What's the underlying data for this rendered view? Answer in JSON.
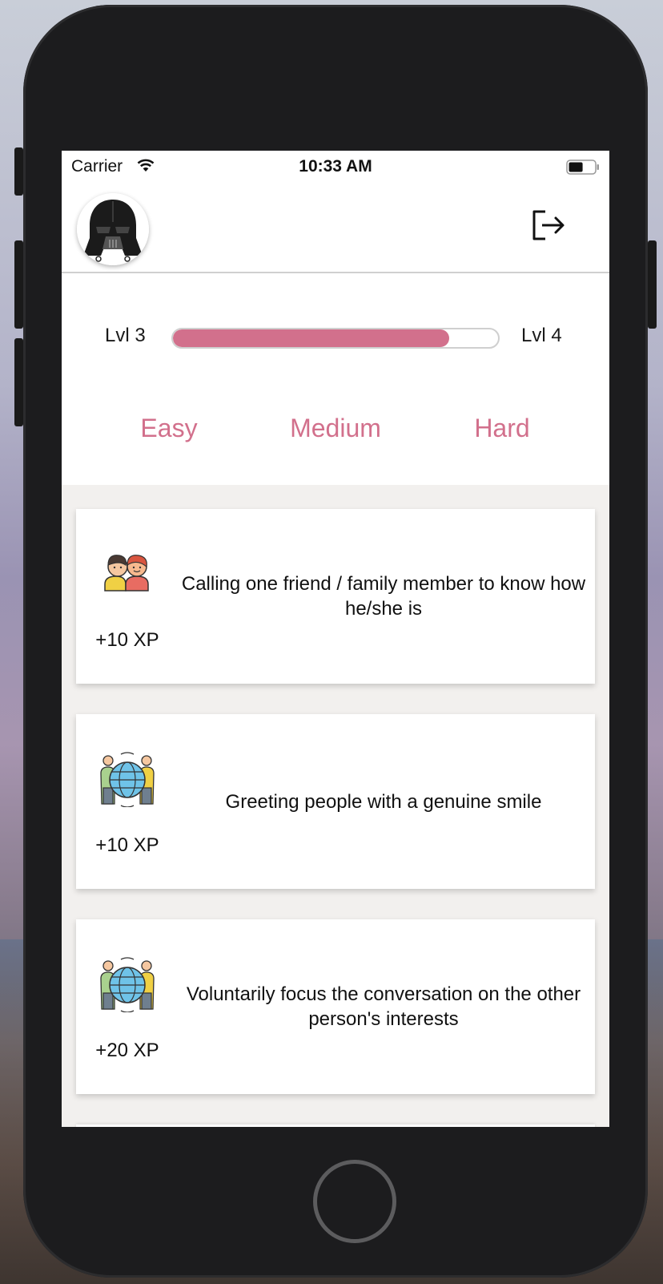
{
  "status_bar": {
    "carrier": "Carrier",
    "time": "10:33 AM",
    "battery_level": 0.55
  },
  "header": {
    "avatar_icon": "darth-vader-helmet-icon",
    "logout_icon": "logout-icon"
  },
  "progress": {
    "current_level": "Lvl 3",
    "next_level": "Lvl 4",
    "fraction": 0.85,
    "fill_color": "#d2708c"
  },
  "tabs": [
    {
      "label": "Easy"
    },
    {
      "label": "Medium"
    },
    {
      "label": "Hard"
    }
  ],
  "challenges": [
    {
      "icon": "two-friends-icon",
      "xp": "+10 XP",
      "text": "Calling one friend / family member to know how he/she is"
    },
    {
      "icon": "people-around-globe-icon",
      "xp": "+10 XP",
      "text": "Greeting people with a genuine smile"
    },
    {
      "icon": "people-around-globe-icon",
      "xp": "+20 XP",
      "text": "Voluntarily focus the conversation on the other person's interests"
    }
  ],
  "accent_color": "#d2708c"
}
